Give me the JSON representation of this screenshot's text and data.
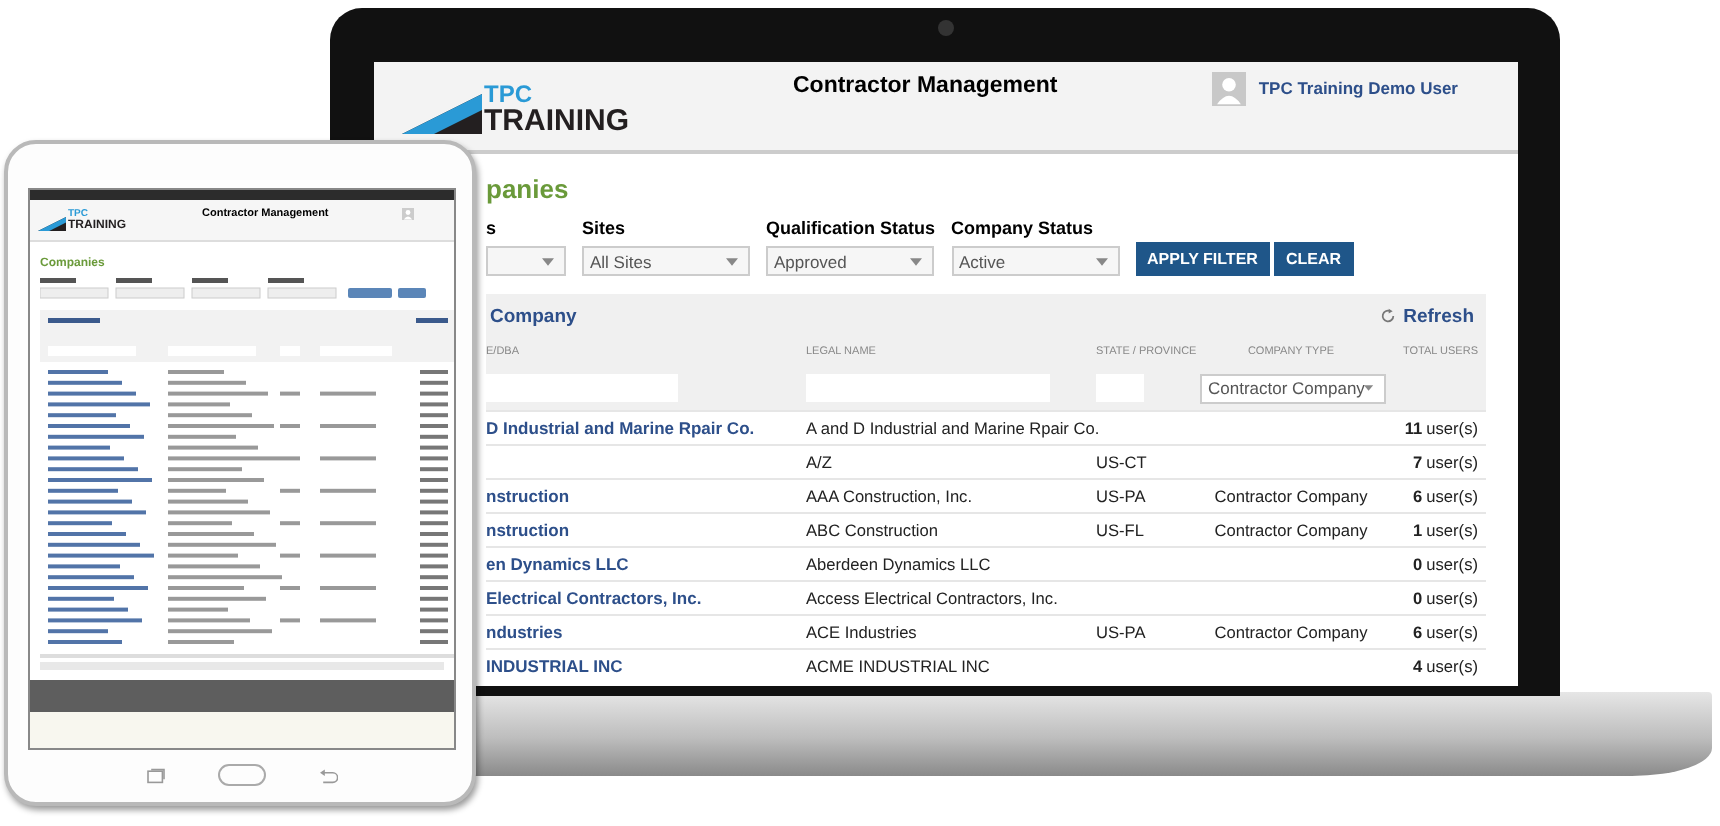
{
  "laptop": {
    "header": {
      "logo": {
        "line1": "TPC",
        "line2": "TRAINING"
      },
      "title": "Contractor Management",
      "user": "TPC Training Demo User"
    },
    "page_title": "panies",
    "filters": [
      {
        "label": "s"
      },
      {
        "label": "Sites",
        "value": "All Sites"
      },
      {
        "label": "Qualification Status",
        "value": "Approved"
      },
      {
        "label": "Company Status",
        "value": "Active"
      }
    ],
    "buttons": [
      "APPLY FILTER",
      "CLEAR"
    ],
    "panel": {
      "title": "Company",
      "refresh": "Refresh",
      "columns": [
        "E/DBA",
        "LEGAL NAME",
        "STATE / PROVINCE",
        "COMPANY TYPE",
        "TOTAL USERS"
      ],
      "type_filter": "Contractor Company",
      "rows": [
        {
          "name": "D Industrial and Marine Rpair Co.",
          "legal": "A and D Industrial and Marine Rpair Co.",
          "state": "",
          "type": "",
          "count": "11",
          "unit": "user(s)"
        },
        {
          "name": "",
          "legal": "A/Z",
          "state": "US-CT",
          "type": "",
          "count": "7",
          "unit": "user(s)"
        },
        {
          "name": "nstruction",
          "legal": "AAA Construction, Inc.",
          "state": "US-PA",
          "type": "Contractor Company",
          "count": "6",
          "unit": "user(s)"
        },
        {
          "name": "nstruction",
          "legal": "ABC Construction",
          "state": "US-FL",
          "type": "Contractor Company",
          "count": "1",
          "unit": "user(s)"
        },
        {
          "name": "en Dynamics LLC",
          "legal": "Aberdeen Dynamics LLC",
          "state": "",
          "type": "",
          "count": "0",
          "unit": "user(s)"
        },
        {
          "name": "Electrical Contractors, Inc.",
          "legal": "Access Electrical Contractors, Inc.",
          "state": "",
          "type": "",
          "count": "0",
          "unit": "user(s)"
        },
        {
          "name": "ndustries",
          "legal": "ACE Industries",
          "state": "US-PA",
          "type": "Contractor Company",
          "count": "6",
          "unit": "user(s)"
        },
        {
          "name": "INDUSTRIAL INC",
          "legal": "ACME INDUSTRIAL INC",
          "state": "",
          "type": "",
          "count": "4",
          "unit": "user(s)"
        }
      ]
    }
  },
  "tablet": {
    "logo": {
      "line1": "TPC",
      "line2": "TRAINING"
    },
    "title": "Contractor Management",
    "page_title": "Companies"
  }
}
